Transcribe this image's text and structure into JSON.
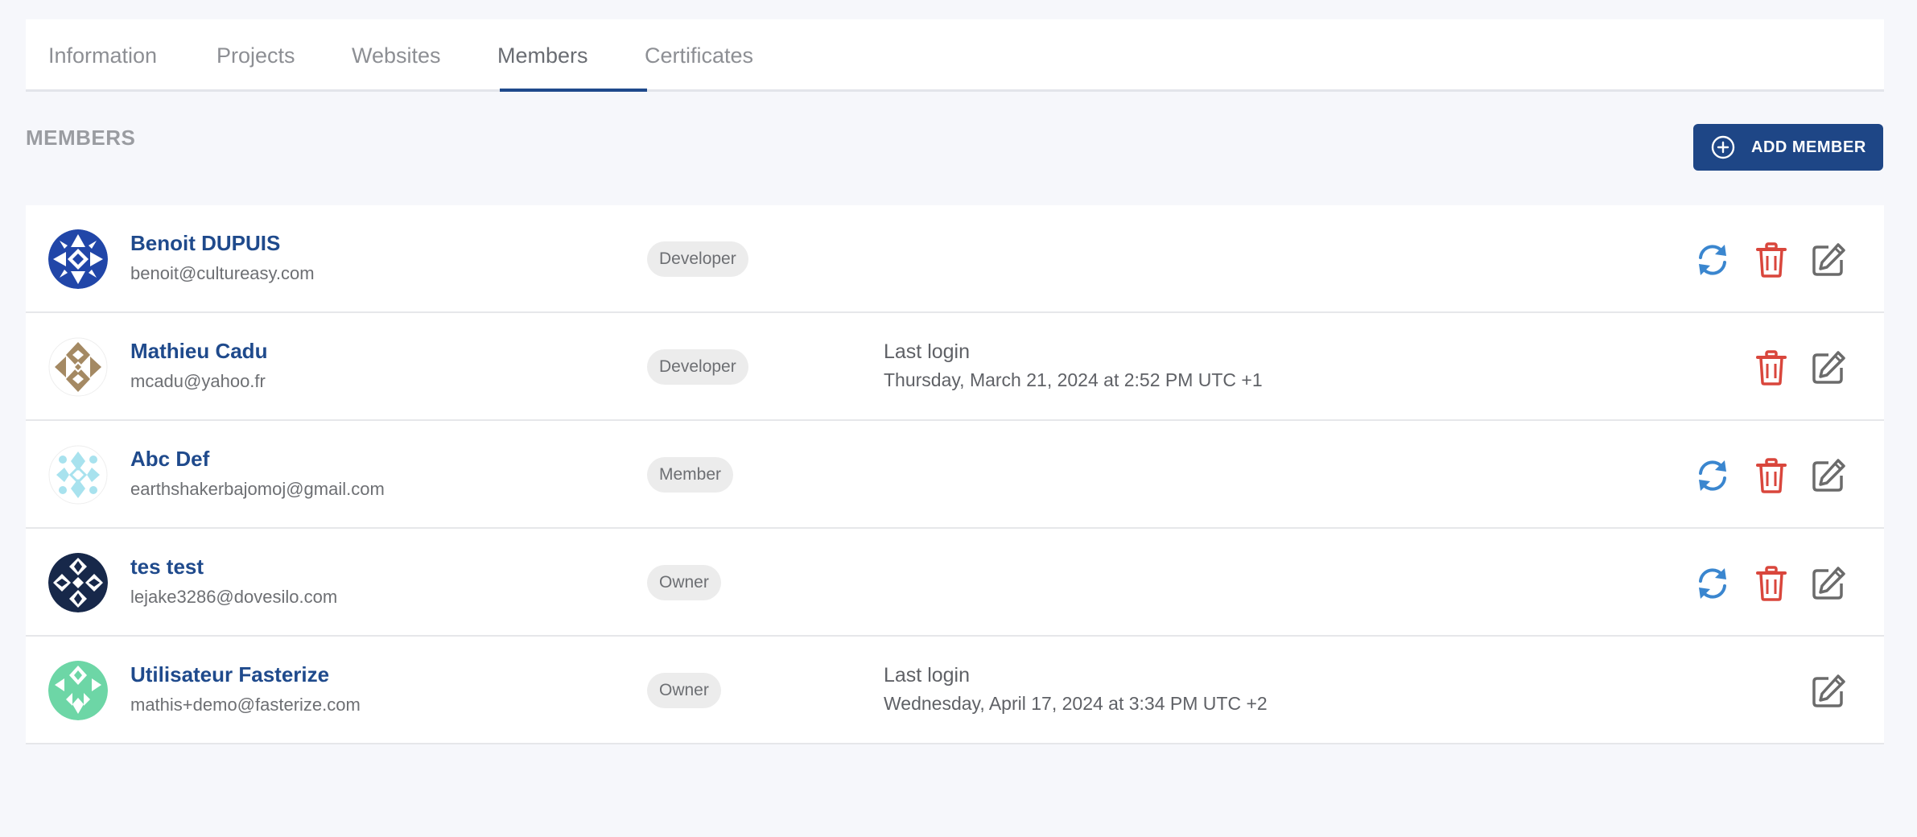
{
  "tabs": [
    {
      "label": "Information"
    },
    {
      "label": "Projects"
    },
    {
      "label": "Websites"
    },
    {
      "label": "Members"
    },
    {
      "label": "Certificates"
    }
  ],
  "active_tab": "Members",
  "section": {
    "title": "MEMBERS",
    "add_button_label": "ADD MEMBER"
  },
  "colors": {
    "brand": "#1e4686",
    "sync_icon": "#3a86cf",
    "delete_icon": "#d9463c",
    "edit_icon": "#6b6b6b"
  },
  "members": [
    {
      "name": "Benoit DUPUIS",
      "email": "benoit@cultureasy.com",
      "role": "Developer",
      "last_login_label": "",
      "last_login": "",
      "actions": [
        "sync-icon",
        "trash-icon",
        "edit-icon"
      ]
    },
    {
      "name": "Mathieu Cadu",
      "email": "mcadu@yahoo.fr",
      "role": "Developer",
      "last_login_label": "Last login",
      "last_login": "Thursday, March 21, 2024 at 2:52 PM UTC +1",
      "actions": [
        "trash-icon",
        "edit-icon"
      ]
    },
    {
      "name": "Abc Def",
      "email": "earthshakerbajomoj@gmail.com",
      "role": "Member",
      "last_login_label": "",
      "last_login": "",
      "actions": [
        "sync-icon",
        "trash-icon",
        "edit-icon"
      ]
    },
    {
      "name": "tes test",
      "email": "lejake3286@dovesilo.com",
      "role": "Owner",
      "last_login_label": "",
      "last_login": "",
      "actions": [
        "sync-icon",
        "trash-icon",
        "edit-icon"
      ]
    },
    {
      "name": "Utilisateur Fasterize",
      "email": "mathis+demo@fasterize.com",
      "role": "Owner",
      "last_login_label": "Last login",
      "last_login": "Wednesday, April 17, 2024 at 3:34 PM UTC +2",
      "actions": [
        "edit-icon"
      ]
    }
  ]
}
